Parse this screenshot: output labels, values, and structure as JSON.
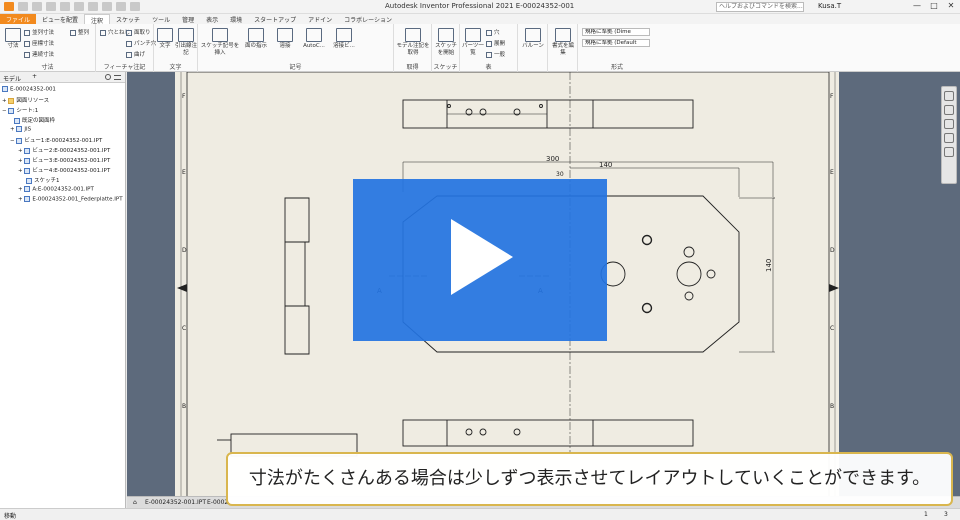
{
  "titlebar": {
    "title": "Autodesk Inventor Professional 2021   E-00024352-001",
    "search_placeholder": "ヘルプおよびコマンドを検索...",
    "user": "Kusa.T",
    "minimize": "—",
    "maximize": "□",
    "close": "✕"
  },
  "tabs": [
    "ファイル",
    "ビューを配置",
    "注釈",
    "スケッチ",
    "ツール",
    "管理",
    "表示",
    "環境",
    "スタートアップ",
    "アドイン",
    "コラボレーション"
  ],
  "ribbon": {
    "dimension": {
      "main": "寸法",
      "items": [
        "並列寸法",
        "座標寸法",
        "連続寸法"
      ],
      "extra": "整列",
      "label": "寸法"
    },
    "feature_notes": {
      "items": [
        "穴とねじ",
        "面取り",
        "パンチ穴",
        "曲げ"
      ],
      "label": "フィーチャ注記"
    },
    "text": {
      "items": [
        "文字",
        "引出線注記"
      ],
      "label": "文字"
    },
    "symbols": {
      "items": [
        "スケッチ記号を挿入",
        "面の指示",
        "溶接",
        "AutoC...",
        "溶接ビ..."
      ],
      "label": "記号"
    },
    "retrieve": {
      "items": [
        "モデル注記を取得"
      ],
      "label": "取得"
    },
    "sketch": {
      "items": [
        "スケッチを開始"
      ],
      "label": "スケッチ"
    },
    "table": {
      "items": [
        "パーツ一覧",
        "穴",
        "展開",
        "一般"
      ],
      "label": "表"
    },
    "balloon": {
      "items": [
        "バルーン"
      ],
      "label": ""
    },
    "style_edit": {
      "items": [
        "書式を編集"
      ],
      "label": ""
    },
    "format": {
      "select1": "規格に準拠 (Dime",
      "select2": "規格に準拠 (Default",
      "label": "形式"
    }
  },
  "browser": {
    "title": "モデル",
    "plus": "+",
    "items": [
      {
        "label": "E-00024352-001",
        "indent": 0
      },
      {
        "label": "図面リソース",
        "indent": 1
      },
      {
        "label": "シート:1",
        "indent": 1
      },
      {
        "label": "既定の図面枠",
        "indent": 2
      },
      {
        "label": "JIS",
        "indent": 2
      },
      {
        "label": "ビュー1:E-00024352-001.IPT",
        "indent": 2
      },
      {
        "label": "ビュー2:E-00024352-001.IPT",
        "indent": 3
      },
      {
        "label": "ビュー3:E-00024352-001.IPT",
        "indent": 3
      },
      {
        "label": "ビュー4:E-00024352-001.IPT",
        "indent": 3
      },
      {
        "label": "スケッチ1",
        "indent": 3
      },
      {
        "label": "A:E-00024352-001.IPT",
        "indent": 3
      },
      {
        "label": "E-00024352-001_Federplatte.IPT",
        "indent": 3
      }
    ]
  },
  "drawing": {
    "dim_300": "300",
    "dim_140_top": "140",
    "dim_30": "30",
    "dim_140_side": "140",
    "section_a_left": "A",
    "section_a_right": "A",
    "zone_letters": [
      "F",
      "E",
      "D",
      "C",
      "B"
    ]
  },
  "sheettabs": {
    "tab1": "E-00024352-001.IPT",
    "tab2": "E-0002"
  },
  "statusbar": {
    "left": "移動",
    "right1": "1",
    "right2": "3"
  },
  "subtitle": "寸法がたくさんある場合は少しずつ表示させてレイアウトしていくことができます。",
  "colors": {
    "sheet": "#efece2",
    "background": "#5d6a7c",
    "overlay": "#2373e1",
    "file_tab": "#f28a1e"
  }
}
